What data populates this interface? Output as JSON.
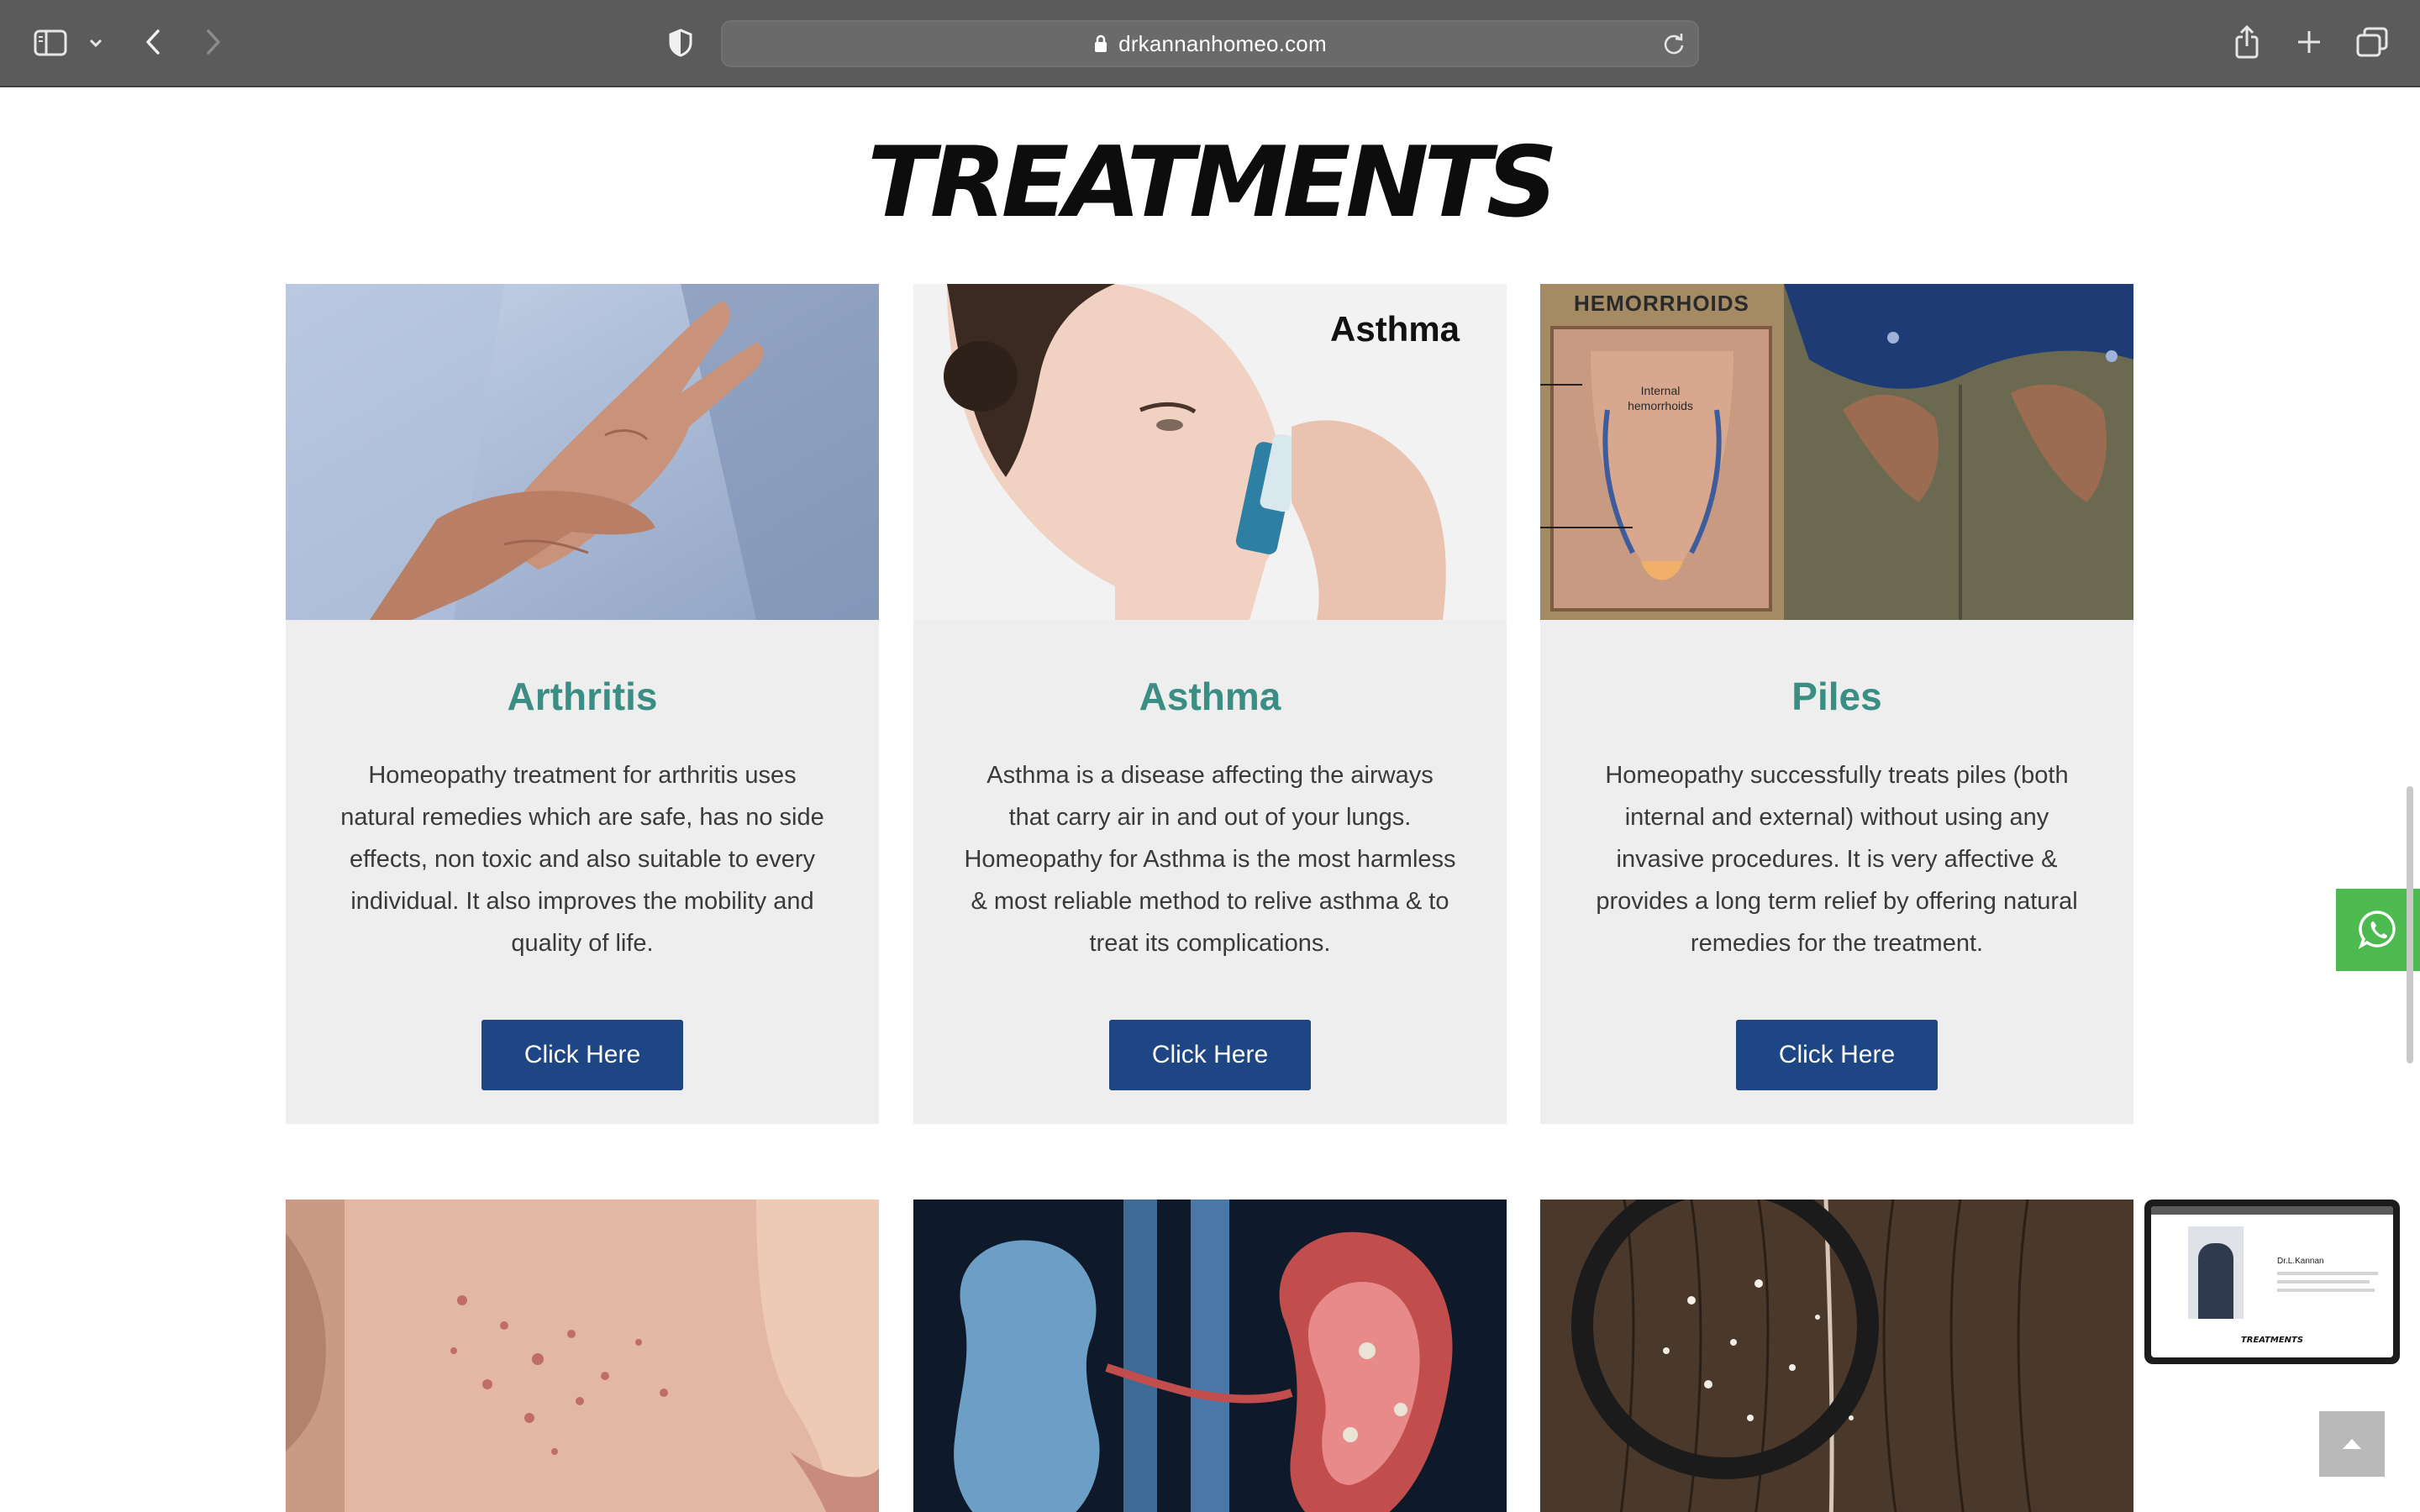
{
  "browser": {
    "url": "drkannanhomeo.com"
  },
  "section": {
    "title": "TREATMENTS"
  },
  "image_labels": {
    "asthma": "Asthma",
    "piles": "HEMORRHOIDS",
    "piles_sub": "Internal hemorrhoids"
  },
  "cards": [
    {
      "title": "Arthritis",
      "description": "Homeopathy treatment for arthritis uses natural remedies which are safe, has no side effects, non toxic and also suitable to every individual. It also improves the mobility and quality of life.",
      "button": "Click Here"
    },
    {
      "title": "Asthma",
      "description": "Asthma is a disease affecting the airways that carry air in and out of your lungs. Homeopathy for Asthma is the most harmless & most reliable method to relive asthma & to treat its complications.",
      "button": "Click Here"
    },
    {
      "title": "Piles",
      "description": "Homeopathy successfully treats piles (both internal and external) without using any invasive procedures. It is very affective & provides a long term relief by offering natural remedies for the treatment.",
      "button": "Click Here"
    }
  ],
  "thumbnail": {
    "name": "Dr.L.Kannan",
    "title": "TREATMENTS"
  },
  "icons": {
    "sidebar": "sidebar-icon",
    "back": "back-arrow-icon",
    "forward": "forward-arrow-icon",
    "shield": "privacy-shield-icon",
    "lock": "lock-icon",
    "reload": "reload-icon",
    "share": "share-icon",
    "new_tab": "plus-icon",
    "tabs": "tabs-overview-icon",
    "whatsapp": "whatsapp-icon",
    "scroll_top": "chevron-up-icon"
  },
  "colors": {
    "accent_title": "#3a8e83",
    "button": "#1e4584",
    "card_bg": "#eeeeee",
    "whatsapp": "#4cba4f"
  }
}
